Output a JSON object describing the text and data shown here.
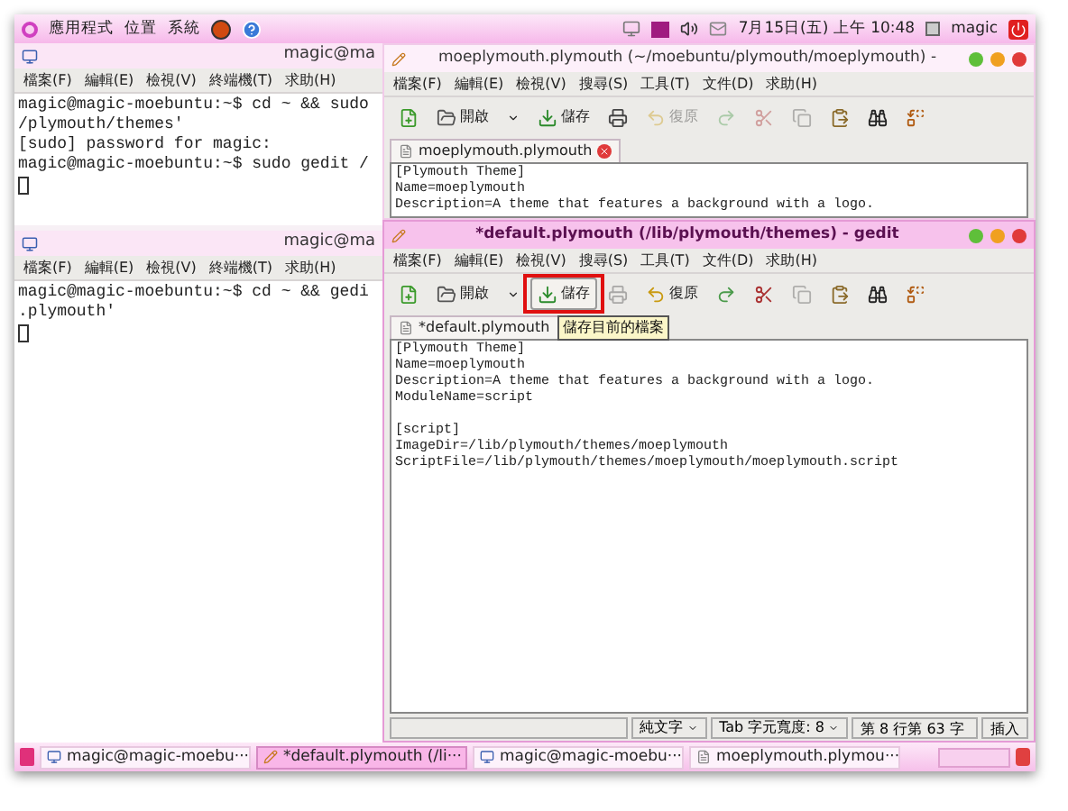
{
  "top_panel": {
    "menus": [
      "應用程式",
      "位置",
      "系統"
    ],
    "clock": "7月15日(五) 上午 10:48",
    "user": "magic"
  },
  "terminals": [
    {
      "title": "magic@ma",
      "menu": [
        "檔案(F)",
        "編輯(E)",
        "檢視(V)",
        "終端機(T)",
        "求助(H)"
      ],
      "lines": [
        "magic@magic-moebuntu:~$ cd ~ && sudo",
        "/plymouth/themes'",
        "[sudo] password for magic:",
        "magic@magic-moebuntu:~$ sudo gedit /"
      ]
    },
    {
      "title": "magic@ma",
      "menu": [
        "檔案(F)",
        "編輯(E)",
        "檢視(V)",
        "終端機(T)",
        "求助(H)"
      ],
      "lines": [
        "magic@magic-moebuntu:~$ cd ~ && gedi",
        ".plymouth'"
      ]
    }
  ],
  "editors": [
    {
      "title": "moeplymouth.plymouth (~/moebuntu/plymouth/moeplymouth) -",
      "focused": false,
      "menu": [
        "檔案(F)",
        "編輯(E)",
        "檢視(V)",
        "搜尋(S)",
        "工具(T)",
        "文件(D)",
        "求助(H)"
      ],
      "toolbar": [
        {
          "kind": "new",
          "disabled": false
        },
        {
          "kind": "open",
          "label": "開啟",
          "disabled": false
        },
        {
          "kind": "dropdown",
          "disabled": false
        },
        {
          "kind": "save",
          "label": "儲存",
          "disabled": false,
          "highlighted": false
        },
        {
          "kind": "print",
          "disabled": false
        },
        {
          "kind": "undo",
          "label": "復原",
          "disabled": true
        },
        {
          "kind": "redo",
          "disabled": true
        },
        {
          "kind": "cut",
          "disabled": true
        },
        {
          "kind": "copy",
          "disabled": true
        },
        {
          "kind": "paste",
          "disabled": false
        },
        {
          "kind": "find",
          "disabled": false
        },
        {
          "kind": "replace",
          "disabled": false
        }
      ],
      "tab": {
        "label": "moeplymouth.plymouth",
        "close": true
      },
      "blocks": [
        {
          "lines": [
            "[Plymouth Theme]",
            "Name=moeplymouth",
            "Description=A theme that features a background with a logo."
          ]
        }
      ]
    },
    {
      "title": "*default.plymouth (/lib/plymouth/themes) - gedit",
      "focused": true,
      "menu": [
        "檔案(F)",
        "編輯(E)",
        "檢視(V)",
        "搜尋(S)",
        "工具(T)",
        "文件(D)",
        "求助(H)"
      ],
      "toolbar": [
        {
          "kind": "new",
          "disabled": false
        },
        {
          "kind": "open",
          "label": "開啟",
          "disabled": false
        },
        {
          "kind": "dropdown",
          "disabled": false
        },
        {
          "kind": "save",
          "label": "儲存",
          "disabled": false,
          "highlighted": true
        },
        {
          "kind": "print",
          "disabled": true
        },
        {
          "kind": "undo",
          "label": "復原",
          "disabled": false
        },
        {
          "kind": "redo",
          "disabled": false
        },
        {
          "kind": "cut",
          "disabled": false
        },
        {
          "kind": "copy",
          "disabled": true
        },
        {
          "kind": "paste",
          "disabled": false
        },
        {
          "kind": "find",
          "disabled": false
        },
        {
          "kind": "replace",
          "disabled": false
        }
      ],
      "tooltip": "儲存目前的檔案",
      "tab": {
        "label": "*default.plymouth",
        "close": false
      },
      "blocks": [
        {
          "lines": [
            "[Plymouth Theme]",
            "Name=moeplymouth",
            "Description=A theme that features a background with a logo.",
            "ModuleName=script"
          ]
        },
        {
          "lines": [
            "[script]",
            "ImageDir=/lib/plymouth/themes/moeplymouth",
            "ScriptFile=/lib/plymouth/themes/moeplymouth/moeplymouth.script"
          ]
        }
      ],
      "status_bar": {
        "language": "純文字",
        "tab_width": "Tab 字元寬度: 8",
        "position": "第 8 行第 63 字",
        "mode": "插入"
      }
    }
  ],
  "taskbar": [
    {
      "kind": "terminal",
      "label": "magic@magic-moebu···",
      "selected": false
    },
    {
      "kind": "editor",
      "label": "*default.plymouth (/li···",
      "selected": true
    },
    {
      "kind": "terminal",
      "label": "magic@magic-moebu···",
      "selected": false
    },
    {
      "kind": "document",
      "label": "moeplymouth.plymou···",
      "selected": false
    }
  ]
}
